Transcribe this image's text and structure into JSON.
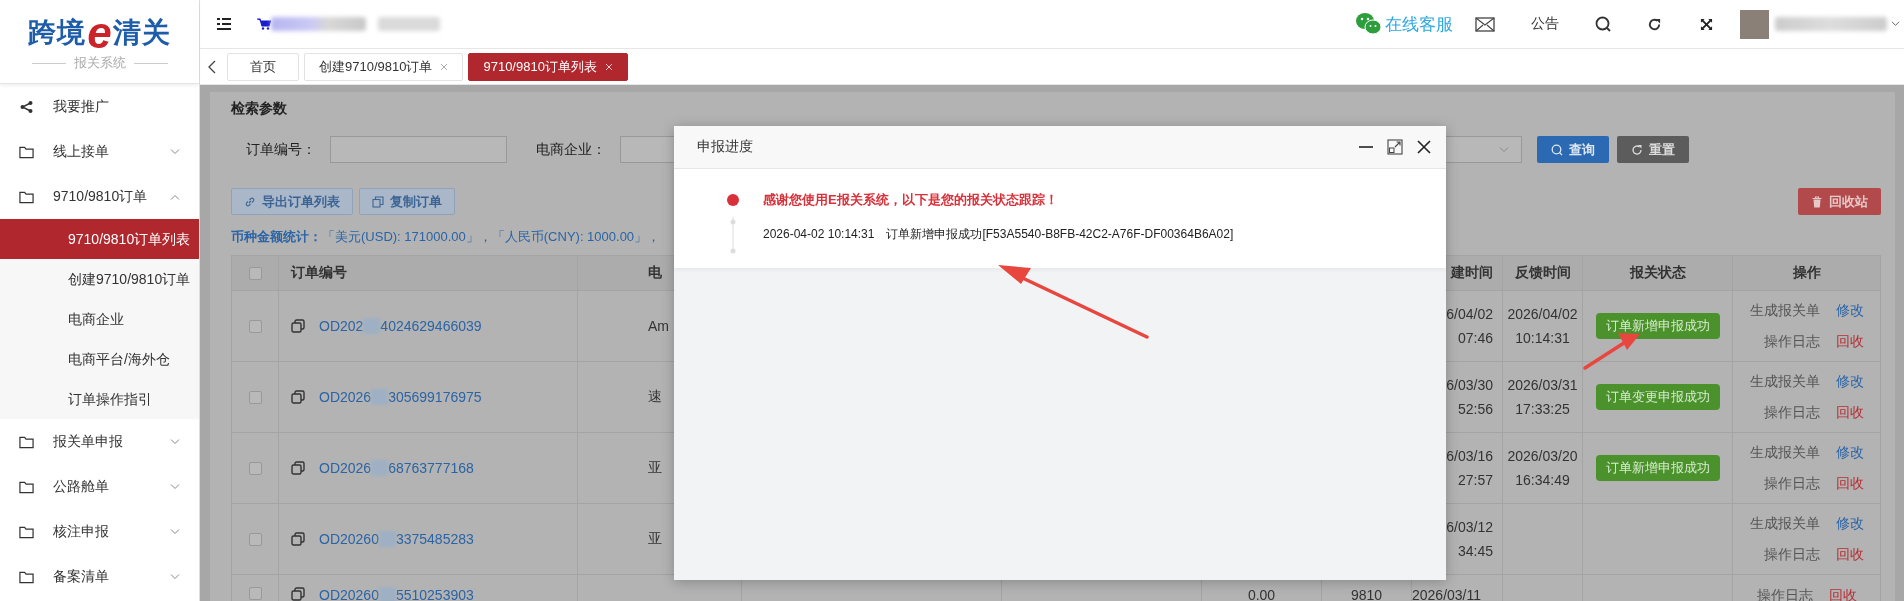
{
  "logo": {
    "left": "跨境",
    "mark": "e",
    "right": "清关",
    "subtitle": "报关系统"
  },
  "sidebar": {
    "items": [
      {
        "label": "我要推广",
        "kind": "share"
      },
      {
        "label": "线上接单",
        "kind": "folder",
        "expanded": false
      },
      {
        "label": "9710/9810订单",
        "kind": "folder",
        "expanded": true,
        "children": [
          {
            "label": "9710/9810订单列表",
            "selected": true
          },
          {
            "label": "创建9710/9810订单",
            "selected": false
          },
          {
            "label": "电商企业",
            "selected": false
          },
          {
            "label": "电商平台/海外仓",
            "selected": false
          },
          {
            "label": "订单操作指引",
            "selected": false
          }
        ]
      },
      {
        "label": "报关单申报",
        "kind": "folder",
        "expanded": false
      },
      {
        "label": "公路舱单",
        "kind": "folder",
        "expanded": false
      },
      {
        "label": "核注申报",
        "kind": "folder",
        "expanded": false
      },
      {
        "label": "备案清单",
        "kind": "folder",
        "expanded": false
      }
    ]
  },
  "topbar": {
    "support": "在线客服",
    "notice": "公告"
  },
  "tabs": [
    {
      "label": "首页",
      "selected": false,
      "closable": false
    },
    {
      "label": "创建9710/9810订单",
      "selected": false,
      "closable": true
    },
    {
      "label": "9710/9810订单列表",
      "selected": true,
      "closable": true
    }
  ],
  "search": {
    "title": "检索参数",
    "fields": [
      {
        "label": "订单编号：",
        "kind": "text"
      },
      {
        "label": "电商企业：",
        "kind": "text"
      },
      {
        "kind": "select"
      }
    ],
    "buttons": [
      {
        "label": "查询",
        "kind": "search"
      },
      {
        "label": "重置",
        "kind": "reset"
      }
    ]
  },
  "toolbar": {
    "buttons": [
      {
        "label": "导出订单列表",
        "kind": "export"
      },
      {
        "label": "复制订单",
        "kind": "copy"
      }
    ],
    "recycle": "回收站"
  },
  "stats": "**币种金额统计：**「美元(USD): 171000.00」，「人民币(CNY): 1000.00」，",
  "table": {
    "select_all": {
      "checked": false
    },
    "columns": {
      "order_no": "订单编号",
      "column_3": "电",
      "created_time": "建时间",
      "feedback_time": "反馈时间",
      "status": "报关状态",
      "actions": "操作"
    },
    "rows": [
      {
        "checked": false,
        "order_prefix": "OD202",
        "order_suffix": "4024629466039",
        "column_3": "Am",
        "created": [
          "6/04/02",
          "07:46"
        ],
        "feedback": [
          "2026/04/02",
          "10:14:31"
        ],
        "status": "订单新增申报成功",
        "actions": [
          {
            "label": "生成报关单",
            "kind": "plain"
          },
          {
            "label": "修改",
            "kind": "edit"
          },
          {
            "label": "操作日志",
            "kind": "plain"
          },
          {
            "label": "回收",
            "kind": "delete"
          }
        ]
      },
      {
        "checked": false,
        "order_prefix": "OD2026",
        "order_suffix": "305699176975",
        "column_3": "速",
        "created": [
          "6/03/30",
          "52:56"
        ],
        "feedback": [
          "2026/03/31",
          "17:33:25"
        ],
        "status": "订单变更申报成功",
        "actions": [
          {
            "label": "生成报关单",
            "kind": "plain"
          },
          {
            "label": "修改",
            "kind": "edit"
          },
          {
            "label": "操作日志",
            "kind": "plain"
          },
          {
            "label": "回收",
            "kind": "delete"
          }
        ]
      },
      {
        "checked": false,
        "order_prefix": "OD2026",
        "order_suffix": "68763777168",
        "column_3": "亚",
        "created": [
          "6/03/16",
          "27:57"
        ],
        "feedback": [
          "2026/03/20",
          "16:34:49"
        ],
        "status": "订单新增申报成功",
        "actions": [
          {
            "label": "生成报关单",
            "kind": "plain"
          },
          {
            "label": "修改",
            "kind": "edit"
          },
          {
            "label": "操作日志",
            "kind": "plain"
          },
          {
            "label": "回收",
            "kind": "delete"
          }
        ]
      },
      {
        "checked": false,
        "order_prefix": "OD20260",
        "order_suffix": "3375485283",
        "column_3": "亚",
        "created": [
          "6/03/12",
          "34:45"
        ],
        "actions": [
          {
            "label": "生成报关单",
            "kind": "plain"
          },
          {
            "label": "修改",
            "kind": "edit"
          },
          {
            "label": "操作日志",
            "kind": "plain"
          },
          {
            "label": "回收",
            "kind": "delete"
          }
        ]
      },
      {
        "checked": false,
        "order_prefix": "OD20260",
        "order_suffix": "5510253903",
        "amount": "0.00",
        "type": "9810",
        "created": [
          "2026/03/11"
        ],
        "actions": [
          {
            "label": "操作日志",
            "kind": "plain"
          },
          {
            "label": "回收",
            "kind": "delete"
          }
        ]
      }
    ]
  },
  "dialog": {
    "title": "申报进度",
    "timeline": [
      {
        "kind": "title",
        "text": "感谢您使用E报关系统，以下是您的报关状态跟踪！"
      },
      {
        "kind": "entry",
        "time": "2026-04-02 10:14:31",
        "text": "订单新增申报成功[F53A5540-B8FB-42C2-A76F-DF00364B6A02]"
      }
    ]
  }
}
